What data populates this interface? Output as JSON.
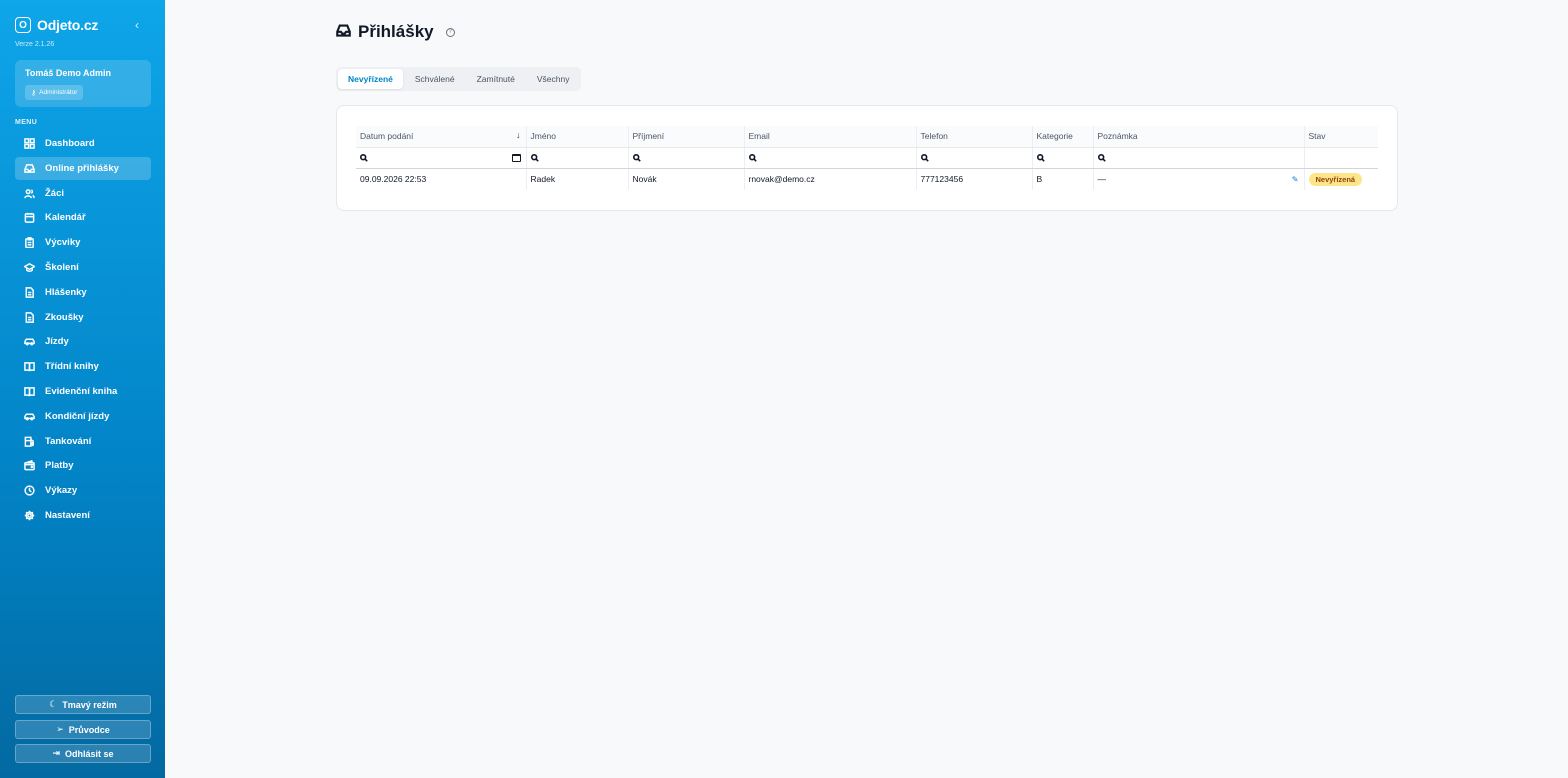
{
  "app": {
    "logo_letter": "O",
    "name": "Odjeto.cz",
    "version": "Verze 2.1.26"
  },
  "user": {
    "name": "Tomáš Demo Admin",
    "role": "Administrátor"
  },
  "menu": {
    "title": "MENU",
    "items": [
      {
        "label": "Dashboard",
        "icon": "dashboard-icon"
      },
      {
        "label": "Online přihlášky",
        "icon": "inbox-icon"
      },
      {
        "label": "Žáci",
        "icon": "users-icon"
      },
      {
        "label": "Kalendář",
        "icon": "calendar-icon"
      },
      {
        "label": "Výcviky",
        "icon": "clipboard-icon"
      },
      {
        "label": "Školení",
        "icon": "graduation-cap-icon"
      },
      {
        "label": "Hlášenky",
        "icon": "document-icon"
      },
      {
        "label": "Zkoušky",
        "icon": "document-icon"
      },
      {
        "label": "Jízdy",
        "icon": "car-icon"
      },
      {
        "label": "Třídní knihy",
        "icon": "book-icon"
      },
      {
        "label": "Evidenční kniha",
        "icon": "book-icon"
      },
      {
        "label": "Kondiční jízdy",
        "icon": "car-icon"
      },
      {
        "label": "Tankování",
        "icon": "fuel-icon"
      },
      {
        "label": "Platby",
        "icon": "wallet-icon"
      },
      {
        "label": "Výkazy",
        "icon": "clock-icon"
      },
      {
        "label": "Nastavení",
        "icon": "gear-icon"
      }
    ]
  },
  "sidebar_buttons": {
    "dark_mode": "Tmavý režim",
    "guide": "Průvodce",
    "logout": "Odhlásit se"
  },
  "page": {
    "title": "Přihlášky",
    "help": "?"
  },
  "tabs": [
    "Nevyřízené",
    "Schválené",
    "Zamítnuté",
    "Všechny"
  ],
  "table": {
    "columns": [
      "Datum podání",
      "Jméno",
      "Příjmení",
      "Email",
      "Telefon",
      "Kategorie",
      "Poznámka",
      "Stav"
    ],
    "sort_indicator": "↓",
    "rows": [
      {
        "date": "09.09.2026 22:53",
        "first_name": "Radek",
        "last_name": "Novák",
        "email": "rnovak@demo.cz",
        "phone": "777123456",
        "category": "B",
        "note": "—",
        "status": "Nevyřízená"
      }
    ]
  },
  "colors": {
    "accent": "#0284c7",
    "sidebar_top": "#0ea5e9",
    "status_pending_bg": "#fde68a",
    "status_pending_text": "#92400e"
  }
}
